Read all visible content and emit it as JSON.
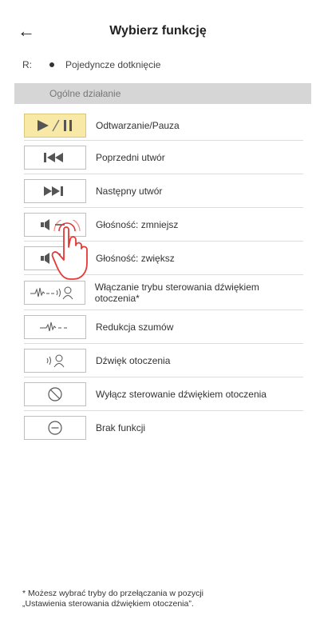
{
  "header": {
    "title": "Wybierz funkcję",
    "back_icon": "arrow-left-icon"
  },
  "selector": {
    "side": "R:",
    "description": "Pojedyncze dotknięcie"
  },
  "section": {
    "title": "Ogólne działanie"
  },
  "functions": [
    {
      "label": "Odtwarzanie/Pauza",
      "icon": "play-pause-icon",
      "selected": true
    },
    {
      "label": "Poprzedni utwór",
      "icon": "previous-track-icon"
    },
    {
      "label": "Następny utwór",
      "icon": "next-track-icon"
    },
    {
      "label": "Głośność: zmniejsz",
      "icon": "volume-down-icon"
    },
    {
      "label": "Głośność: zwiększ",
      "icon": "volume-up-icon"
    },
    {
      "label": "Włączanie trybu sterowania dźwiękiem otoczenia*",
      "icon": "ambient-mode-toggle-icon"
    },
    {
      "label": "Redukcja szumów",
      "icon": "noise-cancel-icon"
    },
    {
      "label": "Dźwięk otoczenia",
      "icon": "ambient-sound-icon"
    },
    {
      "label": "Wyłącz sterowanie dźwiękiem otoczenia",
      "icon": "ambient-off-icon"
    },
    {
      "label": "Brak funkcji",
      "icon": "no-function-icon"
    }
  ],
  "footnote": {
    "line1": "* Możesz wybrać tryby do przełączania w pozycji",
    "line2": "„Ustawienia sterowania dźwiękiem otoczenia”."
  },
  "colors": {
    "selected_bg": "#f9e9a6",
    "section_bg": "#d6d6d6",
    "tap_hand": "#e53935"
  }
}
